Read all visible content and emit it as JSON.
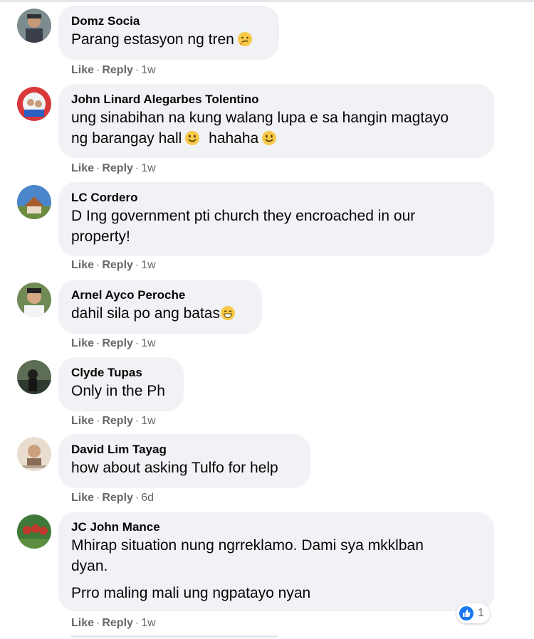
{
  "comments": [
    {
      "author": "Domz Socia",
      "lines": [
        "Parang estasyon ng tren"
      ],
      "emoji": "thinking-face",
      "like": "Like",
      "reply": "Reply",
      "time": "1w"
    },
    {
      "author": "John Linard Alegarbes Tolentino",
      "lines": [
        "ung sinabihan na kung walang lupa e sa hangin magtayo",
        "ng barangay hall",
        "hahaha"
      ],
      "emoji": "smiley-face",
      "like": "Like",
      "reply": "Reply",
      "time": "1w"
    },
    {
      "author": "LC Cordero",
      "lines": [
        "D Ing government pti church they encroached in our",
        "property!"
      ],
      "like": "Like",
      "reply": "Reply",
      "time": "1w"
    },
    {
      "author": "Arnel Ayco Peroche",
      "lines": [
        "dahil sila po ang batas"
      ],
      "emoji": "grinning-face",
      "like": "Like",
      "reply": "Reply",
      "time": "1w"
    },
    {
      "author": "Clyde Tupas",
      "lines": [
        "Only in the Ph"
      ],
      "like": "Like",
      "reply": "Reply",
      "time": "1w"
    },
    {
      "author": "David Lim Tayag",
      "lines": [
        "how about asking Tulfo for help"
      ],
      "like": "Like",
      "reply": "Reply",
      "time": "6d"
    },
    {
      "author": "JC John Mance",
      "lines": [
        "Mhirap situation nung ngrreklamo. Dami sya mkklban",
        "dyan.",
        "Prro maling mali ung ngpatayo nyan"
      ],
      "like": "Like",
      "reply": "Reply",
      "time": "1w",
      "reaction_count": "1",
      "reaction_icon": "like-icon"
    }
  ],
  "separator": "·",
  "colors": {
    "bubble": "#f0f2f5",
    "meta": "#65676b",
    "like_blue": "#1877f2"
  }
}
